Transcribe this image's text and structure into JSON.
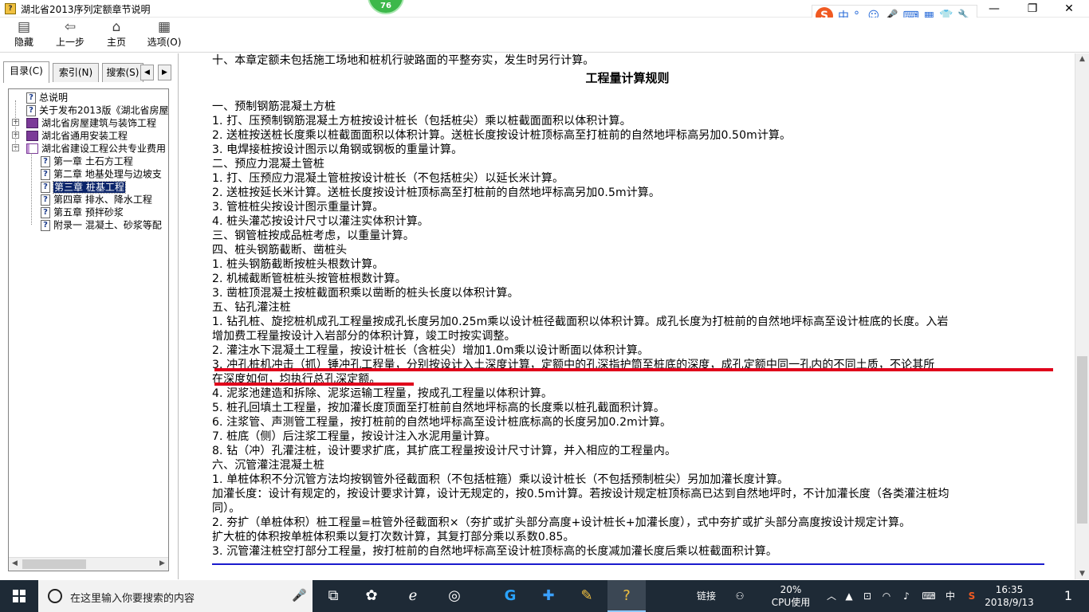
{
  "window": {
    "title": "湖北省2013序列定额章节说明",
    "badge_count": "76",
    "minimize": "—",
    "maximize": "❐",
    "close": "✕"
  },
  "ime": {
    "logo": "S",
    "mode": "中",
    "punct": "°,",
    "emoji": "☺",
    "mic": "🎤",
    "keyboard": "⌨",
    "apps": "▦",
    "skin": "👕",
    "tools": "🔧"
  },
  "toolbar": {
    "hide_label": "隐藏",
    "back_label": "上一步",
    "home_label": "主页",
    "options_label": "选项(O)"
  },
  "tabs": {
    "contents": "目录(C)",
    "index": "索引(N)",
    "search": "搜索(S)"
  },
  "tree": [
    {
      "label": "总说明",
      "type": "page",
      "level": 1
    },
    {
      "label": "关于发布2013版《湖北省房屋",
      "type": "page",
      "level": 1
    },
    {
      "label": "湖北省房屋建筑与装饰工程",
      "type": "book",
      "level": 1,
      "expander": "+"
    },
    {
      "label": "湖北省通用安装工程",
      "type": "book",
      "level": 1,
      "expander": "+"
    },
    {
      "label": "湖北省建设工程公共专业费用",
      "type": "book-open",
      "level": 1,
      "expander": "−"
    },
    {
      "label": "第一章 土石方工程",
      "type": "page",
      "level": 2
    },
    {
      "label": "第二章 地基处理与边坡支",
      "type": "page",
      "level": 2
    },
    {
      "label": "第三章 桩基工程",
      "type": "page",
      "level": 2,
      "selected": true
    },
    {
      "label": "第四章 排水、降水工程",
      "type": "page",
      "level": 2
    },
    {
      "label": "第五章 预拌砂浆",
      "type": "page",
      "level": 2
    },
    {
      "label": "附录一 混凝土、砂浆等配",
      "type": "page",
      "level": 2
    }
  ],
  "content": {
    "first_line": "十、本章定额未包括施工场地和桩机行驶路面的平整夯实，发生时另行计算。",
    "heading": "工程量计算规则",
    "lines": [
      "一、预制钢筋混凝土方桩",
      "1. 打、压预制钢筋混凝土方桩按设计桩长（包括桩尖）乘以桩截面面积以体积计算。",
      "2. 送桩按送桩长度乘以桩截面面积以体积计算。送桩长度按设计桩顶标高至打桩前的自然地坪标高另加0.50m计算。",
      "3. 电焊接桩按设计图示以角钢或钢板的重量计算。",
      "二、预应力混凝土管桩",
      "1. 打、压预应力混凝土管桩按设计桩长（不包括桩尖）以延长米计算。",
      "2. 送桩按延长米计算。送桩长度按设计桩顶标高至打桩前的自然地坪标高另加0.5m计算。",
      "3. 管桩桩尖按设计图示重量计算。",
      "4. 桩头灌芯按设计尺寸以灌注实体积计算。",
      "三、钢管桩按成品桩考虑，以重量计算。",
      "四、桩头钢筋截断、凿桩头",
      "1. 桩头钢筋截断按桩头根数计算。",
      "2. 机械截断管桩桩头按管桩根数计算。",
      "3. 凿桩顶混凝土按桩截面积乘以凿断的桩头长度以体积计算。",
      "五、钻孔灌注桩",
      "1. 钻孔桩、旋挖桩机成孔工程量按成孔长度另加0.25m乘以设计桩径截面积以体积计算。成孔长度为打桩前的自然地坪标高至设计桩底的长度。入岩",
      "增加费工程量按设计入岩部分的体积计算，竣工时按实调整。",
      "2. 灌注水下混凝土工程量，按设计桩长（含桩尖）增加1.0m乘以设计断面以体积计算。",
      "3. 冲孔桩机冲击（抓）锤冲孔工程量，分别按设计入土深度计算，定额中的孔深指护筒至桩底的深度，成孔定额中同一孔内的不同土质，不论其所",
      "在深度如何，均执行总孔深定额。",
      "4. 泥浆池建造和拆除、泥浆运输工程量，按成孔工程量以体积计算。",
      "5. 桩孔回填土工程量，按加灌长度顶面至打桩前自然地坪标高的长度乘以桩孔截面积计算。",
      "6. 注浆管、声测管工程量，按打桩前的自然地坪标高至设计桩底标高的长度另加0.2m计算。",
      "7. 桩底（侧）后注浆工程量，按设计注入水泥用量计算。",
      "8. 钻（冲）孔灌注桩，设计要求扩底，其扩底工程量按设计尺寸计算，并入相应的工程量内。",
      "六、沉管灌注混凝土桩",
      "1. 单桩体积不分沉管方法均按钢管外径截面积（不包括桩箍）乘以设计桩长（不包括预制桩尖）另加加灌长度计算。",
      "加灌长度：设计有规定的，按设计要求计算，设计无规定的，按0.5m计算。若按设计规定桩顶标高已达到自然地坪时，不计加灌长度（各类灌注桩均",
      "同）。",
      "2. 夯扩（单桩体积）桩工程量=桩管外径截面积×（夯扩或扩头部分高度+设计桩长+加灌长度），式中夯扩或扩头部分高度按设计规定计算。",
      "扩大桩的体积按单桩体积乘以复打次数计算，其复打部分乘以系数0.85。",
      "3. 沉管灌注桩空打部分工程量，按打桩前的自然地坪标高至设计桩顶标高的长度减加灌长度后乘以桩截面积计算。"
    ]
  },
  "taskbar": {
    "search_placeholder": "在这里输入你要搜索的内容",
    "link_label": "链接",
    "cpu_percent": "20%",
    "cpu_label": "CPU使用",
    "ime_lang": "中",
    "time": "16:35",
    "date": "2018/9/13",
    "notification_count": "1"
  },
  "colors": {
    "selection": "#0a246a",
    "annotation_red": "#e0001b",
    "rule_blue": "#1a1acd",
    "taskbar": "#1e2a36"
  }
}
